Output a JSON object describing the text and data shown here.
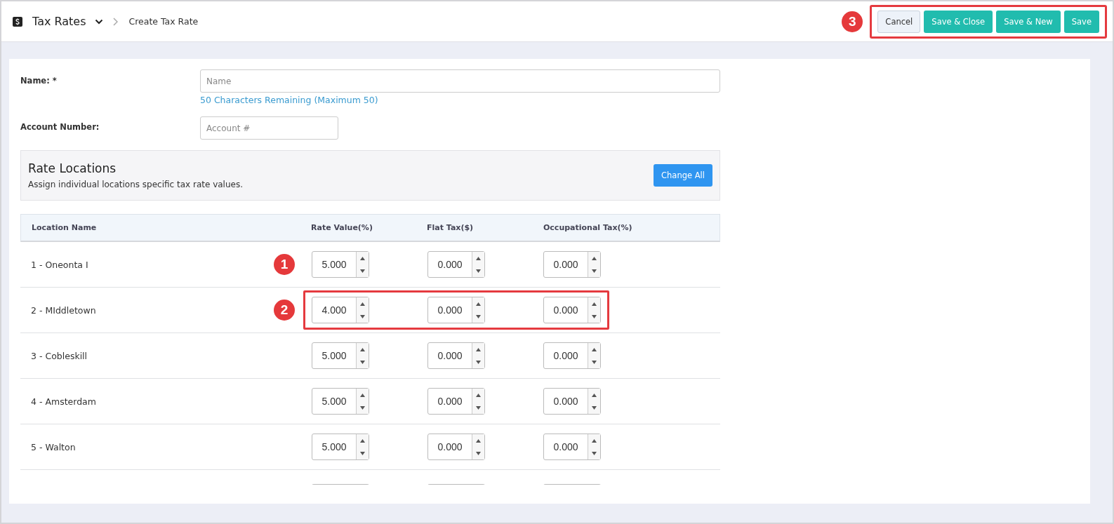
{
  "header": {
    "module": "Tax Rates",
    "breadcrumb": "Create Tax Rate",
    "callout": "3",
    "actions_highlighted": true,
    "actions": [
      {
        "label": "Cancel",
        "kind": "secondary"
      },
      {
        "label": "Save & Close",
        "kind": "primary"
      },
      {
        "label": "Save & New",
        "kind": "primary"
      },
      {
        "label": "Save",
        "kind": "primary"
      }
    ]
  },
  "form": {
    "name_label": "Name: *",
    "name_placeholder": "Name",
    "name_hint": "50 Characters Remaining (Maximum 50)",
    "account_label": "Account Number:",
    "account_placeholder": "Account #"
  },
  "rate_locations": {
    "title": "Rate Locations",
    "description": "Assign individual locations specific tax rate values.",
    "button": "Change All"
  },
  "table": {
    "columns": [
      "Location Name",
      "Rate Value(%)",
      "Flat Tax($)",
      "Occupational Tax(%)"
    ],
    "rows": [
      {
        "kind": "full",
        "name": "1 - Oneonta I",
        "values": [
          "5.000",
          "0.000",
          "0.000"
        ],
        "callout": "1",
        "highlighted": false
      },
      {
        "kind": "full",
        "name": "2 - MIddletown",
        "values": [
          "4.000",
          "0.000",
          "0.000"
        ],
        "callout": "2",
        "highlighted": true
      },
      {
        "kind": "full",
        "name": "3 - Cobleskill",
        "values": [
          "5.000",
          "0.000",
          "0.000"
        ],
        "highlighted": false
      },
      {
        "kind": "full",
        "name": "4 - Amsterdam",
        "values": [
          "5.000",
          "0.000",
          "0.000"
        ],
        "highlighted": false
      },
      {
        "kind": "full",
        "name": "5 - Walton",
        "values": [
          "5.000",
          "0.000",
          "0.000"
        ],
        "highlighted": false
      },
      {
        "kind": "partial"
      }
    ]
  }
}
